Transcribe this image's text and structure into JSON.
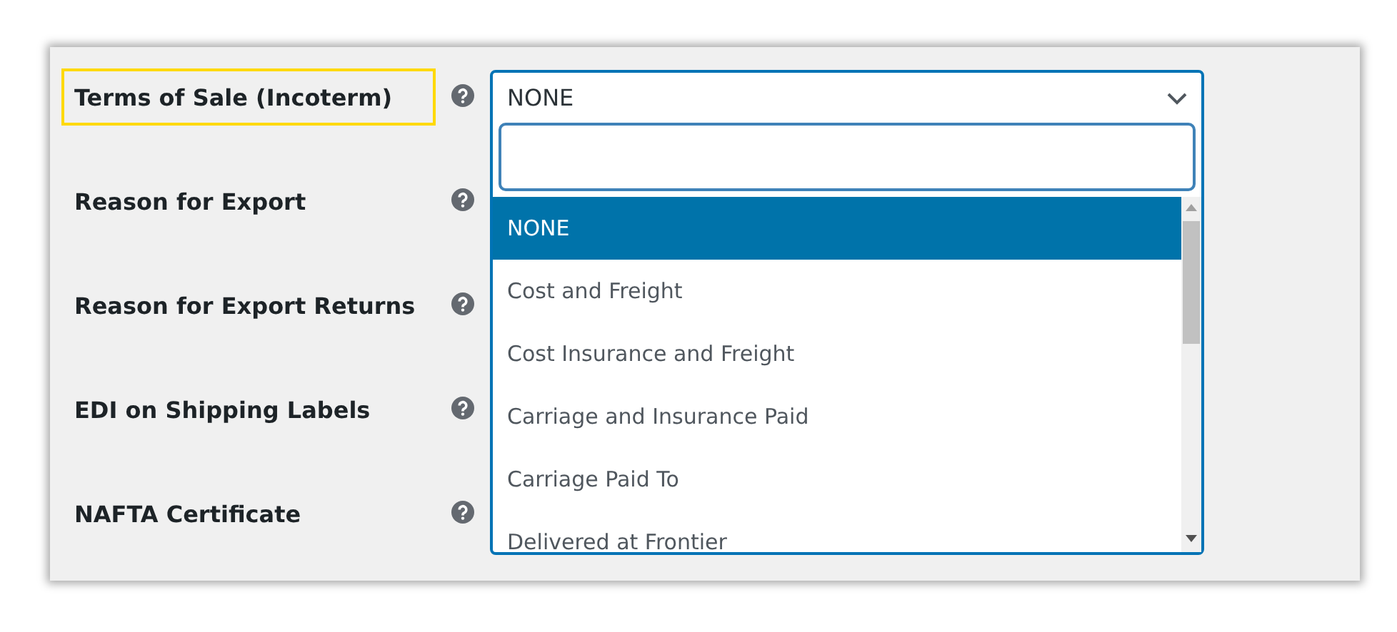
{
  "fields": [
    {
      "label": "Terms of Sale (Incoterm)",
      "highlighted": true
    },
    {
      "label": "Reason for Export",
      "highlighted": false
    },
    {
      "label": "Reason for Export Returns",
      "highlighted": false
    },
    {
      "label": "EDI on Shipping Labels",
      "highlighted": false
    },
    {
      "label": "NAFTA Certificate",
      "highlighted": false
    }
  ],
  "dropdown": {
    "value": "NONE",
    "expanded": true,
    "options": [
      {
        "label": "NONE",
        "selected": true
      },
      {
        "label": "Cost and Freight",
        "selected": false
      },
      {
        "label": "Cost Insurance and Freight",
        "selected": false
      },
      {
        "label": "Carriage and Insurance Paid",
        "selected": false
      },
      {
        "label": "Carriage Paid To",
        "selected": false
      },
      {
        "label": "Delivered at Frontier",
        "selected": false
      }
    ]
  }
}
